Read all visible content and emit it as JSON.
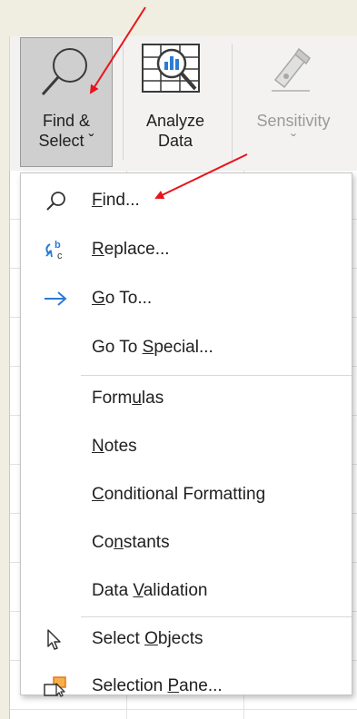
{
  "ribbon": {
    "find_select": {
      "line1": "Find &",
      "line2": "Select ˇ"
    },
    "analyze": {
      "line1": "Analyze",
      "line2": "Data"
    },
    "sensitivity": {
      "line1": "Sensitivity",
      "line2": "ˇ"
    }
  },
  "menu": {
    "items": [
      {
        "label": "Find...",
        "underline": "F",
        "icon": "search-icon"
      },
      {
        "label": "Replace...",
        "underline": "R",
        "icon": "replace-icon"
      },
      {
        "label": "Go To...",
        "underline": "G",
        "icon": "arrow-right-icon"
      },
      {
        "label": "Go To Special...",
        "underline": "S"
      },
      {
        "label": "Formulas",
        "underline": "u"
      },
      {
        "label": "Notes",
        "underline": "N"
      },
      {
        "label": "Conditional Formatting",
        "underline": "C"
      },
      {
        "label": "Constants",
        "underline": "n"
      },
      {
        "label": "Data Validation",
        "underline": "V"
      },
      {
        "label": "Select Objects",
        "underline": "O",
        "icon": "cursor-icon"
      },
      {
        "label": "Selection Pane...",
        "underline": "P",
        "icon": "selection-pane-icon"
      }
    ]
  },
  "colors": {
    "annotation_arrow": "#e8141b",
    "goto_arrow": "#2b7cd3",
    "replace_icon": "#2b7cd3",
    "selection_pane": "#e8761b"
  }
}
